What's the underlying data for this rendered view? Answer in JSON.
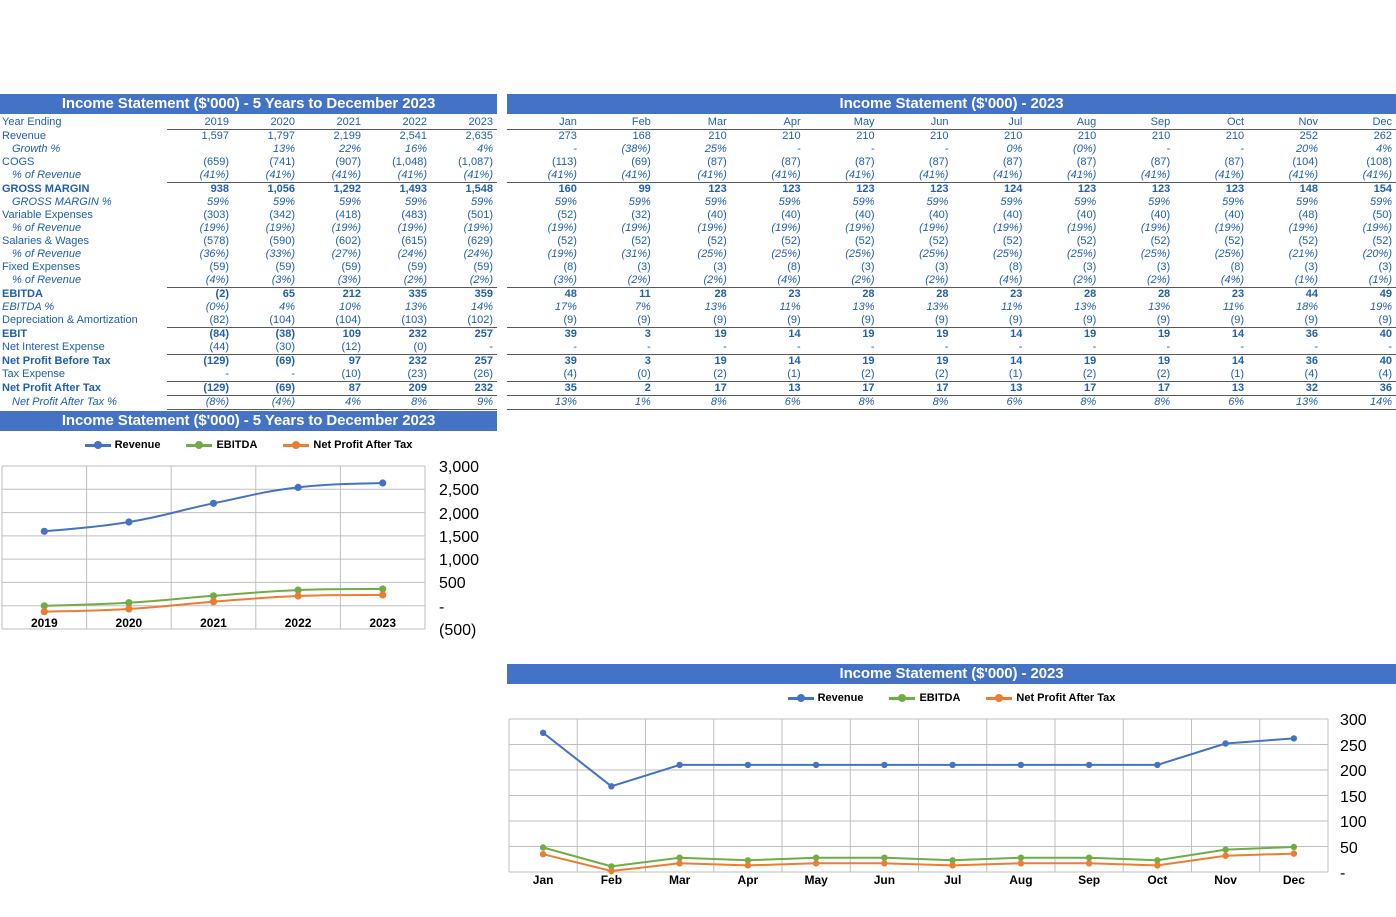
{
  "colors": {
    "header_blue": "#4472C4",
    "text_blue": "#1F5FAE",
    "revenue": "#4472C4",
    "ebitda": "#70AD47",
    "npat": "#ED7D31",
    "grid": "#BFBFBF",
    "rule": "#595959"
  },
  "left_panel": {
    "title": "Income Statement ($'000) - 5 Years to December 2023",
    "header_label": "Year Ending",
    "columns": [
      "2019",
      "2020",
      "2021",
      "2022",
      "2023"
    ],
    "rows": [
      {
        "label": "Revenue",
        "style": "plain",
        "values": [
          "1,597",
          "1,797",
          "2,199",
          "2,541",
          "2,635"
        ]
      },
      {
        "label": "Growth %",
        "style": "indent-italic",
        "values": [
          "",
          "13%",
          "22%",
          "16%",
          "4%"
        ]
      },
      {
        "label": "COGS",
        "style": "plain",
        "values": [
          "(659)",
          "(741)",
          "(907)",
          "(1,048)",
          "(1,087)"
        ]
      },
      {
        "label": "% of Revenue",
        "style": "indent-italic",
        "values": [
          "(41%)",
          "(41%)",
          "(41%)",
          "(41%)",
          "(41%)"
        ]
      },
      {
        "label": "GROSS MARGIN",
        "style": "bold-topline",
        "values": [
          "938",
          "1,056",
          "1,292",
          "1,493",
          "1,548"
        ]
      },
      {
        "label": "GROSS MARGIN %",
        "style": "indent-italic",
        "values": [
          "59%",
          "59%",
          "59%",
          "59%",
          "59%"
        ]
      },
      {
        "label": "Variable Expenses",
        "style": "plain",
        "values": [
          "(303)",
          "(342)",
          "(418)",
          "(483)",
          "(501)"
        ]
      },
      {
        "label": "% of Revenue",
        "style": "indent-italic",
        "values": [
          "(19%)",
          "(19%)",
          "(19%)",
          "(19%)",
          "(19%)"
        ]
      },
      {
        "label": "Salaries & Wages",
        "style": "plain",
        "values": [
          "(578)",
          "(590)",
          "(602)",
          "(615)",
          "(629)"
        ]
      },
      {
        "label": "% of Revenue",
        "style": "indent-italic",
        "values": [
          "(36%)",
          "(33%)",
          "(27%)",
          "(24%)",
          "(24%)"
        ]
      },
      {
        "label": "Fixed Expenses",
        "style": "plain",
        "values": [
          "(59)",
          "(59)",
          "(59)",
          "(59)",
          "(59)"
        ]
      },
      {
        "label": "% of Revenue",
        "style": "indent-italic",
        "values": [
          "(4%)",
          "(3%)",
          "(3%)",
          "(2%)",
          "(2%)"
        ]
      },
      {
        "label": "EBITDA",
        "style": "bold-topline",
        "values": [
          "(2)",
          "65",
          "212",
          "335",
          "359"
        ]
      },
      {
        "label": "EBITDA %",
        "style": "italic",
        "values": [
          "(0%)",
          "4%",
          "10%",
          "13%",
          "14%"
        ]
      },
      {
        "label": "Depreciation & Amortization",
        "style": "plain",
        "values": [
          "(82)",
          "(104)",
          "(104)",
          "(103)",
          "(102)"
        ]
      },
      {
        "label": "EBIT",
        "style": "bold-topline",
        "values": [
          "(84)",
          "(38)",
          "109",
          "232",
          "257"
        ]
      },
      {
        "label": "Net Interest Expense",
        "style": "plain",
        "values": [
          "(44)",
          "(30)",
          "(12)",
          "(0)",
          "-"
        ]
      },
      {
        "label": "Net Profit Before Tax",
        "style": "bold-topline",
        "values": [
          "(129)",
          "(69)",
          "97",
          "232",
          "257"
        ]
      },
      {
        "label": "Tax Expense",
        "style": "plain",
        "values": [
          "-",
          "-",
          "(10)",
          "(23)",
          "(26)"
        ]
      },
      {
        "label": "Net Profit After Tax",
        "style": "bold-topline",
        "values": [
          "(129)",
          "(69)",
          "87",
          "209",
          "232"
        ]
      },
      {
        "label": "Net Profit After Tax %",
        "style": "indent-italic-dbl",
        "values": [
          "(8%)",
          "(4%)",
          "4%",
          "8%",
          "9%"
        ]
      }
    ]
  },
  "right_panel": {
    "title": "Income Statement ($'000) - 2023",
    "columns": [
      "Jan",
      "Feb",
      "Mar",
      "Apr",
      "May",
      "Jun",
      "Jul",
      "Aug",
      "Sep",
      "Oct",
      "Nov",
      "Dec"
    ],
    "rows": [
      {
        "label": "Revenue",
        "style": "plain",
        "values": [
          "273",
          "168",
          "210",
          "210",
          "210",
          "210",
          "210",
          "210",
          "210",
          "210",
          "252",
          "262"
        ]
      },
      {
        "label": "Growth %",
        "style": "indent-italic",
        "values": [
          "-",
          "(38%)",
          "25%",
          "-",
          "-",
          "-",
          "0%",
          "(0%)",
          "-",
          "-",
          "20%",
          "4%"
        ]
      },
      {
        "label": "COGS",
        "style": "plain",
        "values": [
          "(113)",
          "(69)",
          "(87)",
          "(87)",
          "(87)",
          "(87)",
          "(87)",
          "(87)",
          "(87)",
          "(87)",
          "(104)",
          "(108)"
        ]
      },
      {
        "label": "% of Revenue",
        "style": "indent-italic",
        "values": [
          "(41%)",
          "(41%)",
          "(41%)",
          "(41%)",
          "(41%)",
          "(41%)",
          "(41%)",
          "(41%)",
          "(41%)",
          "(41%)",
          "(41%)",
          "(41%)"
        ]
      },
      {
        "label": "GROSS MARGIN",
        "style": "bold-topline",
        "values": [
          "160",
          "99",
          "123",
          "123",
          "123",
          "123",
          "124",
          "123",
          "123",
          "123",
          "148",
          "154"
        ]
      },
      {
        "label": "GROSS MARGIN %",
        "style": "indent-italic",
        "values": [
          "59%",
          "59%",
          "59%",
          "59%",
          "59%",
          "59%",
          "59%",
          "59%",
          "59%",
          "59%",
          "59%",
          "59%"
        ]
      },
      {
        "label": "Variable Expenses",
        "style": "plain",
        "values": [
          "(52)",
          "(32)",
          "(40)",
          "(40)",
          "(40)",
          "(40)",
          "(40)",
          "(40)",
          "(40)",
          "(40)",
          "(48)",
          "(50)"
        ]
      },
      {
        "label": "% of Revenue",
        "style": "indent-italic",
        "values": [
          "(19%)",
          "(19%)",
          "(19%)",
          "(19%)",
          "(19%)",
          "(19%)",
          "(19%)",
          "(19%)",
          "(19%)",
          "(19%)",
          "(19%)",
          "(19%)"
        ]
      },
      {
        "label": "Salaries & Wages",
        "style": "plain",
        "values": [
          "(52)",
          "(52)",
          "(52)",
          "(52)",
          "(52)",
          "(52)",
          "(52)",
          "(52)",
          "(52)",
          "(52)",
          "(52)",
          "(52)"
        ]
      },
      {
        "label": "% of Revenue",
        "style": "indent-italic",
        "values": [
          "(19%)",
          "(31%)",
          "(25%)",
          "(25%)",
          "(25%)",
          "(25%)",
          "(25%)",
          "(25%)",
          "(25%)",
          "(25%)",
          "(21%)",
          "(20%)"
        ]
      },
      {
        "label": "Fixed Expenses",
        "style": "plain",
        "values": [
          "(8)",
          "(3)",
          "(3)",
          "(8)",
          "(3)",
          "(3)",
          "(8)",
          "(3)",
          "(3)",
          "(8)",
          "(3)",
          "(3)"
        ]
      },
      {
        "label": "% of Revenue",
        "style": "indent-italic",
        "values": [
          "(3%)",
          "(2%)",
          "(2%)",
          "(4%)",
          "(2%)",
          "(2%)",
          "(4%)",
          "(2%)",
          "(2%)",
          "(4%)",
          "(1%)",
          "(1%)"
        ]
      },
      {
        "label": "EBITDA",
        "style": "bold-topline",
        "values": [
          "48",
          "11",
          "28",
          "23",
          "28",
          "28",
          "23",
          "28",
          "28",
          "23",
          "44",
          "49"
        ]
      },
      {
        "label": "EBITDA %",
        "style": "italic",
        "values": [
          "17%",
          "7%",
          "13%",
          "11%",
          "13%",
          "13%",
          "11%",
          "13%",
          "13%",
          "11%",
          "18%",
          "19%"
        ]
      },
      {
        "label": "Depreciation & Amortization",
        "style": "plain",
        "values": [
          "(9)",
          "(9)",
          "(9)",
          "(9)",
          "(9)",
          "(9)",
          "(9)",
          "(9)",
          "(9)",
          "(9)",
          "(9)",
          "(9)"
        ]
      },
      {
        "label": "EBIT",
        "style": "bold-topline",
        "values": [
          "39",
          "3",
          "19",
          "14",
          "19",
          "19",
          "14",
          "19",
          "19",
          "14",
          "36",
          "40"
        ]
      },
      {
        "label": "Net Interest Expense",
        "style": "plain",
        "values": [
          "-",
          "-",
          "-",
          "-",
          "-",
          "-",
          "-",
          "-",
          "-",
          "-",
          "-",
          "-"
        ]
      },
      {
        "label": "Net Profit Before Tax",
        "style": "bold-topline",
        "values": [
          "39",
          "3",
          "19",
          "14",
          "19",
          "19",
          "14",
          "19",
          "19",
          "14",
          "36",
          "40"
        ]
      },
      {
        "label": "Tax Expense",
        "style": "plain",
        "values": [
          "(4)",
          "(0)",
          "(2)",
          "(1)",
          "(2)",
          "(2)",
          "(1)",
          "(2)",
          "(2)",
          "(1)",
          "(4)",
          "(4)"
        ]
      },
      {
        "label": "Net Profit After Tax",
        "style": "bold-topline",
        "values": [
          "35",
          "2",
          "17",
          "13",
          "17",
          "17",
          "13",
          "17",
          "17",
          "13",
          "32",
          "36"
        ]
      },
      {
        "label": "Net Profit After Tax %",
        "style": "indent-italic-dbl",
        "values": [
          "13%",
          "1%",
          "8%",
          "6%",
          "8%",
          "8%",
          "6%",
          "8%",
          "8%",
          "6%",
          "13%",
          "14%"
        ]
      }
    ]
  },
  "legend": {
    "items": [
      {
        "name": "Revenue",
        "color": "#4472C4"
      },
      {
        "name": "EBITDA",
        "color": "#70AD47"
      },
      {
        "name": "Net Profit After Tax",
        "color": "#ED7D31"
      }
    ]
  },
  "chart_data": [
    {
      "id": "annual-chart",
      "type": "line",
      "title": "Income Statement ($'000) - 5 Years to December 2023",
      "categories": [
        "2019",
        "2020",
        "2021",
        "2022",
        "2023"
      ],
      "series": [
        {
          "name": "Revenue",
          "color": "#4472C4",
          "values": [
            1597,
            1797,
            2199,
            2541,
            2635
          ]
        },
        {
          "name": "EBITDA",
          "color": "#70AD47",
          "values": [
            -2,
            65,
            212,
            335,
            359
          ]
        },
        {
          "name": "Net Profit After Tax",
          "color": "#ED7D31",
          "values": [
            -129,
            -69,
            87,
            209,
            232
          ]
        }
      ],
      "ylim": [
        -500,
        3000
      ],
      "ytick_step": 500,
      "yticks": [
        "3,000",
        "2,500",
        "2,000",
        "1,500",
        "1,000",
        "500",
        "-",
        "(500)"
      ],
      "xlabel": "",
      "ylabel": "",
      "grid": true,
      "smooth": true,
      "legend_position": "top"
    },
    {
      "id": "monthly-chart",
      "type": "line",
      "title": "Income Statement ($'000) - 2023",
      "categories": [
        "Jan",
        "Feb",
        "Mar",
        "Apr",
        "May",
        "Jun",
        "Jul",
        "Aug",
        "Sep",
        "Oct",
        "Nov",
        "Dec"
      ],
      "series": [
        {
          "name": "Revenue",
          "color": "#4472C4",
          "values": [
            273,
            168,
            210,
            210,
            210,
            210,
            210,
            210,
            210,
            210,
            252,
            262
          ]
        },
        {
          "name": "EBITDA",
          "color": "#70AD47",
          "values": [
            48,
            11,
            28,
            23,
            28,
            28,
            23,
            28,
            28,
            23,
            44,
            49
          ]
        },
        {
          "name": "Net Profit After Tax",
          "color": "#ED7D31",
          "values": [
            35,
            2,
            17,
            13,
            17,
            17,
            13,
            17,
            17,
            13,
            32,
            36
          ]
        }
      ],
      "ylim": [
        0,
        300
      ],
      "ytick_step": 50,
      "yticks": [
        "300",
        "250",
        "200",
        "150",
        "100",
        "50",
        "-"
      ],
      "xlabel": "",
      "ylabel": "",
      "grid": true,
      "smooth": false,
      "legend_position": "top"
    }
  ]
}
